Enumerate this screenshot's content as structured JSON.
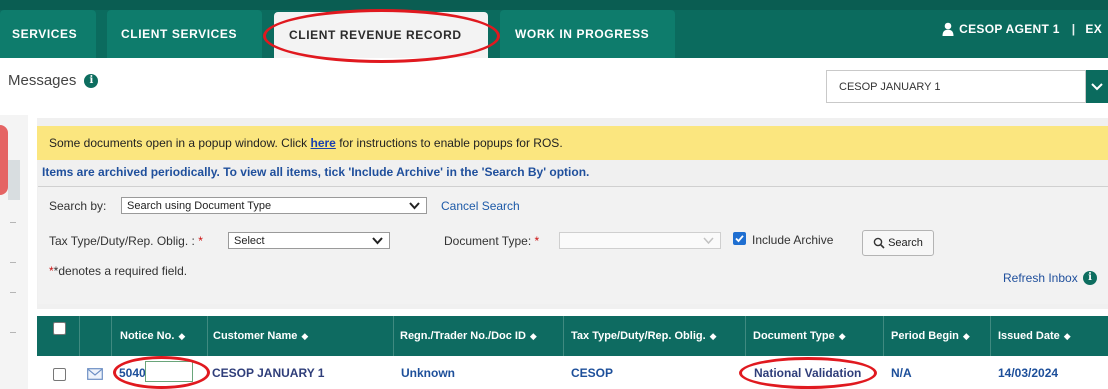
{
  "nav": {
    "tabs": [
      {
        "label": "SERVICES",
        "active": false
      },
      {
        "label": "CLIENT SERVICES",
        "active": false
      },
      {
        "label": "CLIENT REVENUE RECORD",
        "active": true
      },
      {
        "label": "WORK IN PROGRESS",
        "active": false
      }
    ],
    "user_label": "CESOP AGENT 1",
    "exit_label": "EX"
  },
  "header": {
    "title": "Messages",
    "client_select_value": "CESOP JANUARY 1"
  },
  "notice": {
    "text_before": "Some documents open in a popup window. Click ",
    "link": "here",
    "text_after": " for instructions to enable popups for ROS."
  },
  "archive_note": "Items are archived periodically. To view all items, tick 'Include Archive' in the 'Search By' option.",
  "search": {
    "search_by_label": "Search by:",
    "search_by_value": "Search using Document Type",
    "cancel_label": "Cancel Search",
    "tax_type_label": "Tax Type/Duty/Rep. Oblig. :",
    "tax_type_value": "Select",
    "document_type_label": "Document Type:",
    "document_type_value": "",
    "required_marker": "*",
    "include_archive_label": "Include Archive",
    "include_archive_checked": true,
    "search_button": "Search",
    "required_note": "*denotes a required field.",
    "refresh_label": "Refresh Inbox"
  },
  "table": {
    "columns": [
      "Notice No.",
      "Customer Name",
      "Regn./Trader No./Doc ID",
      "Tax Type/Duty/Rep. Oblig.",
      "Document Type",
      "Period Begin",
      "Issued Date"
    ],
    "rows": [
      {
        "notice_no": "5040",
        "customer_name": "CESOP JANUARY 1",
        "regn": "Unknown",
        "tax_type": "CESOP",
        "document_type": "National Validation",
        "period_begin": "N/A",
        "issued_date": "14/03/2024"
      }
    ]
  },
  "colors": {
    "brand_teal": "#0b6b5e",
    "notice_yellow": "#fbe67f",
    "annotation_red": "#e0191f",
    "link_blue": "#1d5aa8"
  }
}
